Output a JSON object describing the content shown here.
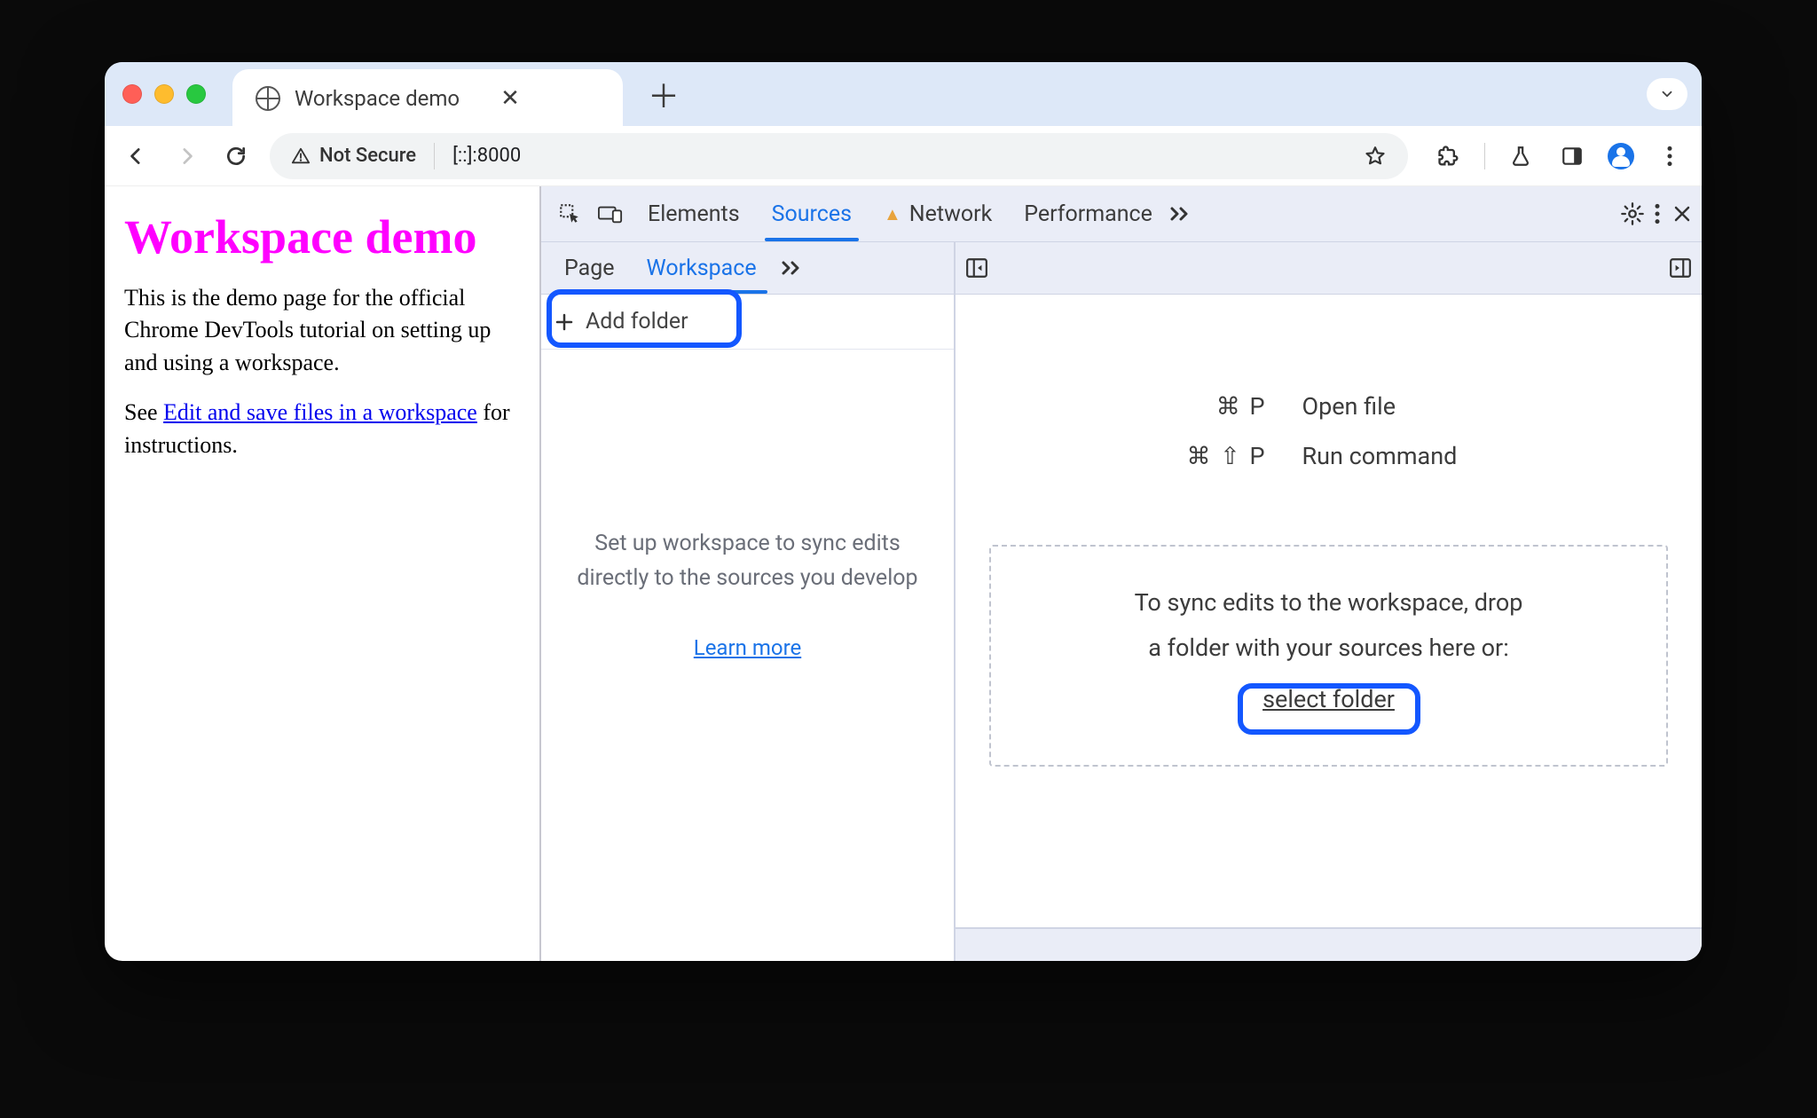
{
  "tabstrip": {
    "tab_title": "Workspace demo"
  },
  "toolbar": {
    "not_secure": "Not Secure",
    "url": "[::]:8000"
  },
  "page": {
    "h1": "Workspace demo",
    "p1": "This is the demo page for the official Chrome DevTools tutorial on setting up and using a workspace.",
    "p2a": "See ",
    "p2_link": "Edit and save files in a workspace",
    "p2b": " for instructions."
  },
  "devtools": {
    "tabs": {
      "elements": "Elements",
      "sources": "Sources",
      "network": "Network",
      "performance": "Performance"
    },
    "subtabs": {
      "page": "Page",
      "workspace": "Workspace"
    },
    "addfolder": "Add folder",
    "sidebar_msg": "Set up workspace to sync edits directly to the sources you develop",
    "learn_more": "Learn more",
    "shortcuts": {
      "open_file_key": "⌘  P",
      "open_file_label": "Open file",
      "run_cmd_key": "⌘ ⇧ P",
      "run_cmd_label": "Run command"
    },
    "drop": {
      "line1": "To sync edits to the workspace, drop",
      "line2": "a folder with your sources here or:",
      "select_folder": "select folder"
    }
  }
}
